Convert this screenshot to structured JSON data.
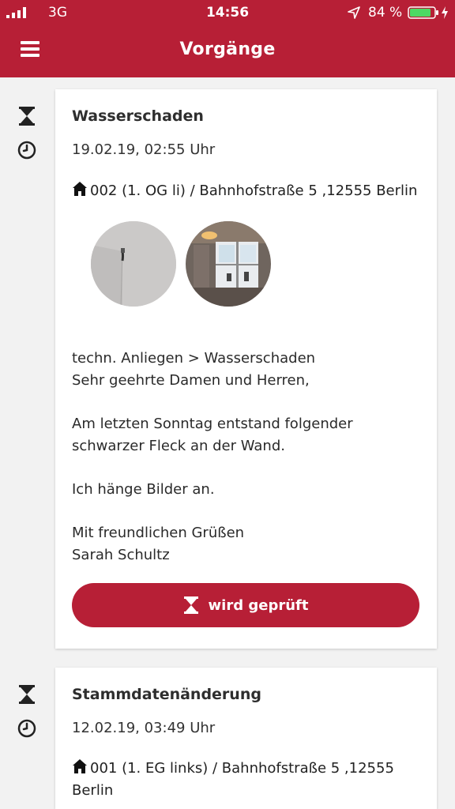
{
  "status_bar": {
    "network": "3G",
    "time": "14:56",
    "battery_percent": "84 %"
  },
  "header": {
    "title": "Vorgänge"
  },
  "cases": [
    {
      "title": "Wasserschaden",
      "date": "19.02.19, 02:55 Uhr",
      "address": "002 (1. OG li) / Bahnhofstraße 5 ,12555 Berlin",
      "category": "techn. Anliegen > Wasserschaden",
      "greeting": "Sehr geehrte Damen und Herren,",
      "body_line1": "Am letzten Sonntag entstand folgender",
      "body_line2": "schwarzer Fleck an der Wand.",
      "attachment_note": "Ich hänge Bilder an.",
      "closing": "Mit freundlichen Grüßen",
      "signature": "Sarah Schultz",
      "status_label": "wird geprüft"
    },
    {
      "title": "Stammdatenänderung",
      "date": "12.02.19, 03:49 Uhr",
      "address_line1": "001 (1. EG links) / Bahnhofstraße 5 ,12555",
      "address_line2": "Berlin"
    }
  ],
  "colors": {
    "brand": "#b71f36",
    "background": "#f2f2f2",
    "battery": "#4cd964"
  }
}
